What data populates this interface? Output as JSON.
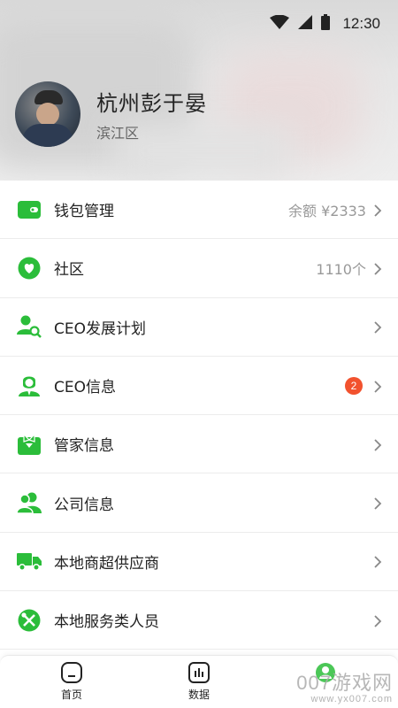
{
  "status_bar": {
    "time": "12:30",
    "icons": [
      "wifi-icon",
      "signal-icon",
      "battery-icon"
    ]
  },
  "profile": {
    "name": "杭州彭于晏",
    "district": "滨江区"
  },
  "colors": {
    "accent": "#2bbd3a",
    "badge": "#f2522e",
    "muted_text": "#999999"
  },
  "menu": {
    "items": [
      {
        "label": "钱包管理",
        "value": "余额 ¥2333",
        "icon": "wallet-icon"
      },
      {
        "label": "社区",
        "value": "1110个",
        "icon": "community-chat-icon"
      },
      {
        "label": "CEO发展计划",
        "value": "",
        "icon": "person-search-icon"
      },
      {
        "label": "CEO信息",
        "badge": "2",
        "icon": "ceo-person-icon"
      },
      {
        "label": "管家信息",
        "value": "",
        "icon": "butler-icon"
      },
      {
        "label": "公司信息",
        "value": "",
        "icon": "company-people-icon"
      },
      {
        "label": "本地商超供应商",
        "value": "",
        "icon": "delivery-truck-icon"
      },
      {
        "label": "本地服务类人员",
        "value": "",
        "icon": "tools-icon"
      }
    ]
  },
  "bottom_nav": {
    "items": [
      {
        "label": "首页",
        "icon": "home-icon"
      },
      {
        "label": "数据",
        "icon": "data-chart-icon"
      },
      {
        "label": "",
        "icon": "profile-icon"
      }
    ]
  },
  "watermark": {
    "text": "007游戏网",
    "sub": "www.yx007.com"
  }
}
